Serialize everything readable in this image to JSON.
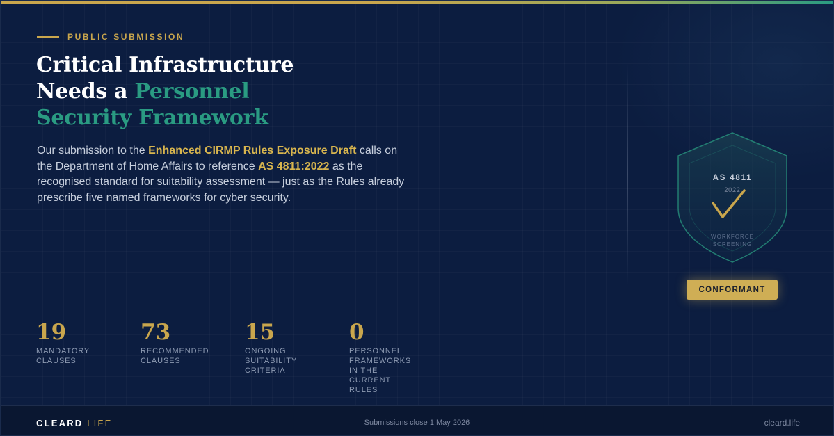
{
  "hero": {
    "eyebrow": "PUBLIC SUBMISSION",
    "headline_line1": "Critical Infrastructure",
    "headline_line2_plain": "Needs a ",
    "headline_line2_accent": "Personnel",
    "headline_line3_accent": "Security Framework",
    "lede_part1": "Our submission to the ",
    "lede_highlight1": "Enhanced CIRMP Rules Exposure Draft",
    "lede_part2": " calls on the Department of Home Affairs to reference ",
    "lede_highlight2": "AS 4811:2022",
    "lede_part3": " as the recognised standard for suitability assessment — just as the Rules already prescribe five named frameworks for cyber security."
  },
  "stats": [
    {
      "number": "19",
      "label": "MANDATORY CLAUSES"
    },
    {
      "number": "73",
      "label": "RECOMMENDED CLAUSES"
    },
    {
      "number": "15",
      "label": "ONGOING SUITABILITY CRITERIA"
    },
    {
      "number": "0",
      "label": "PERSONNEL FRAMEWORKS IN THE CURRENT RULES"
    }
  ],
  "shield": {
    "standard": "AS 4811",
    "year": "2022",
    "caption": "WORKFORCE SCREENING",
    "badge": "CONFORMANT"
  },
  "footer": {
    "brand_main": "CLEARD",
    "brand_accent": "LIFE",
    "deadline": "Submissions close 1 May 2026",
    "site": "cleard.life"
  },
  "colors": {
    "background": "#0c1d40",
    "gold": "#c9a64d",
    "teal": "#2a9b82",
    "text": "#c7cfdd"
  },
  "icons": {
    "shield": "shield-icon",
    "check": "checkmark-icon"
  }
}
